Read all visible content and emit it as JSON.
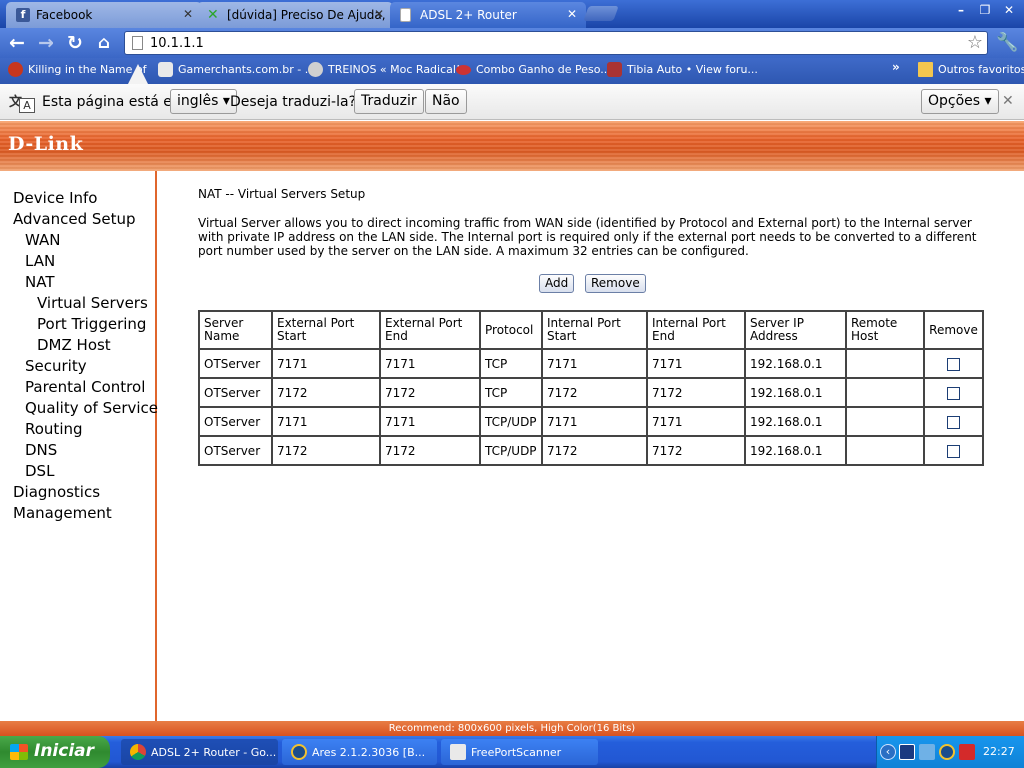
{
  "browser": {
    "tabs": [
      {
        "label": "Facebook",
        "favicon_color": "#3b5998"
      },
      {
        "label": "[dúvida] Preciso De Ajuda, N",
        "favicon_color": "#2ba52b"
      },
      {
        "label": "ADSL 2+ Router",
        "favicon_color": "#ffffff"
      }
    ],
    "url": "10.1.1.1",
    "bookmarks": [
      {
        "label": "Killing in the Name of",
        "color": "#c7361d"
      },
      {
        "label": "Gamerchants.com.br - ...",
        "color": "#e9e9e9"
      },
      {
        "label": "TREINOS « Moc Radical!",
        "color": "#d0d0d0"
      },
      {
        "label": "Combo Ganho de Peso...",
        "color": "#c33"
      },
      {
        "label": "Tibia Auto • View foru...",
        "color": "#a33"
      },
      {
        "label": "Outros favoritos",
        "color": "#f3c64f"
      }
    ],
    "bookmarks_overflow": "»"
  },
  "translate_bar": {
    "prefix": "Esta página está em",
    "language": "inglês ▾",
    "question": "Deseja traduzi-la?",
    "translate_label": "Traduzir",
    "no_label": "Não",
    "options_label": "Opções ▾",
    "close": "✕"
  },
  "router": {
    "logo": "D-Link",
    "menu": [
      {
        "label": "Device Info",
        "level": 0
      },
      {
        "label": "Advanced Setup",
        "level": 0
      },
      {
        "label": "WAN",
        "level": 1
      },
      {
        "label": "LAN",
        "level": 1
      },
      {
        "label": "NAT",
        "level": 1
      },
      {
        "label": "Virtual Servers",
        "level": 2
      },
      {
        "label": "Port Triggering",
        "level": 2
      },
      {
        "label": "DMZ Host",
        "level": 2
      },
      {
        "label": "Security",
        "level": 1
      },
      {
        "label": "Parental Control",
        "level": 1
      },
      {
        "label": "Quality of Service",
        "level": 1
      },
      {
        "label": "Routing",
        "level": 1
      },
      {
        "label": "DNS",
        "level": 1
      },
      {
        "label": "DSL",
        "level": 1
      },
      {
        "label": "Diagnostics",
        "level": 0
      },
      {
        "label": "Management",
        "level": 0
      }
    ],
    "title": "NAT -- Virtual Servers Setup",
    "description": "Virtual Server allows you to direct incoming traffic from WAN side (identified by Protocol and External port) to the Internal server with private IP address on the LAN side. The Internal port is required only if the external port needs to be converted to a different port number used by the server on the LAN side. A maximum 32 entries can be configured.",
    "add_label": "Add",
    "remove_label": "Remove",
    "table": {
      "headers": [
        "Server Name",
        "External Port Start",
        "External Port End",
        "Protocol",
        "Internal Port Start",
        "Internal Port End",
        "Server IP Address",
        "Remote Host",
        "Remove"
      ],
      "rows": [
        [
          "OTServer",
          "7171",
          "7171",
          "TCP",
          "7171",
          "7171",
          "192.168.0.1",
          ""
        ],
        [
          "OTServer",
          "7172",
          "7172",
          "TCP",
          "7172",
          "7172",
          "192.168.0.1",
          ""
        ],
        [
          "OTServer",
          "7171",
          "7171",
          "TCP/UDP",
          "7171",
          "7171",
          "192.168.0.1",
          ""
        ],
        [
          "OTServer",
          "7172",
          "7172",
          "TCP/UDP",
          "7172",
          "7172",
          "192.168.0.1",
          ""
        ]
      ]
    },
    "recommend": "Recommend: 800x600 pixels, High Color(16 Bits)"
  },
  "taskbar": {
    "start_label": "Iniciar",
    "tasks": [
      {
        "label": "ADSL 2+ Router - Go...",
        "active": true
      },
      {
        "label": "Ares 2.1.2.3036   [B...",
        "active": false
      },
      {
        "label": "FreePortScanner",
        "active": false
      }
    ],
    "clock": "22:27"
  }
}
